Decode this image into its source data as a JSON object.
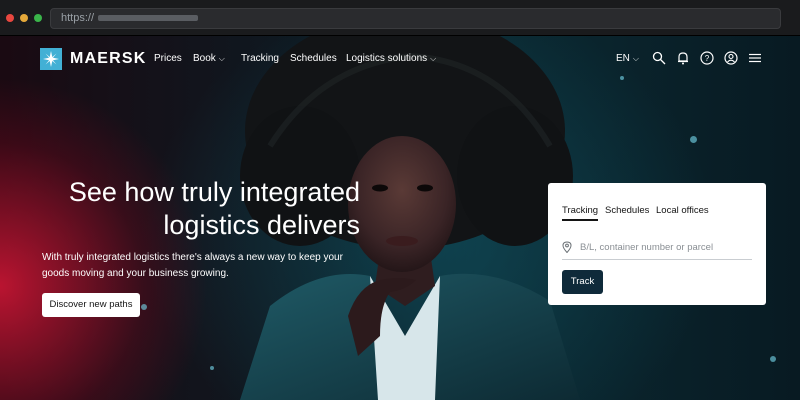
{
  "browser": {
    "url_prefix": "https://"
  },
  "brand": {
    "name": "MAERSK",
    "colors": {
      "logo": "#42b0d5",
      "primary_button": "#0f2a3a",
      "hero_red": "#d61636",
      "hero_teal": "#125868"
    }
  },
  "nav": {
    "items": [
      {
        "label": "Prices",
        "has_dropdown": false
      },
      {
        "label": "Book",
        "has_dropdown": true
      },
      {
        "label": "Tracking",
        "has_dropdown": false
      },
      {
        "label": "Schedules",
        "has_dropdown": false
      },
      {
        "label": "Logistics solutions",
        "has_dropdown": true
      }
    ],
    "language": "EN",
    "icons": [
      "search-icon",
      "bell-icon",
      "help-icon",
      "user-icon",
      "menu-icon"
    ]
  },
  "hero": {
    "title_line1": "See how truly integrated",
    "title_line2": "logistics delivers",
    "subtitle_line1": "With truly integrated logistics there's always a new way to keep your",
    "subtitle_line2": "goods moving and your business growing.",
    "cta_label": "Discover new paths"
  },
  "tracking_card": {
    "tabs": [
      "Tracking",
      "Schedules",
      "Local offices"
    ],
    "active_tab": "Tracking",
    "input_placeholder": "B/L, container number or parcel",
    "input_value": "",
    "button_label": "Track"
  }
}
